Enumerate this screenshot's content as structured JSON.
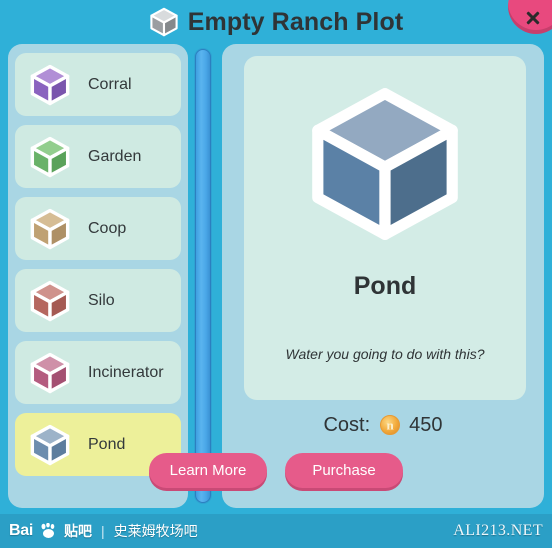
{
  "header": {
    "title": "Empty Ranch Plot",
    "icon": "cube-icon"
  },
  "close_button": {
    "icon": "close-icon",
    "color": "#e8497e"
  },
  "sidebar": {
    "background": "#a9d6e4",
    "items": [
      {
        "label": "Corral",
        "icon": "cube-icon",
        "top": "#b18fd6",
        "left": "#8a63bf",
        "right": "#7a55ad",
        "selected": false
      },
      {
        "label": "Garden",
        "icon": "cube-icon",
        "top": "#93ce8e",
        "left": "#6ab269",
        "right": "#5aa25a",
        "selected": false
      },
      {
        "label": "Coop",
        "icon": "cube-icon",
        "top": "#d6bd95",
        "left": "#bfa173",
        "right": "#ae9065",
        "selected": false
      },
      {
        "label": "Silo",
        "icon": "cube-icon",
        "top": "#cf928c",
        "left": "#b5675f",
        "right": "#a55a53",
        "selected": false
      },
      {
        "label": "Incinerator",
        "icon": "cube-icon",
        "top": "#cf90a8",
        "left": "#b45c7f",
        "right": "#a45072",
        "selected": false
      },
      {
        "label": "Pond",
        "icon": "cube-icon",
        "top": "#9db3c9",
        "left": "#6d8dae",
        "right": "#5d7d9e",
        "selected": true
      }
    ],
    "selected_background": "#edf09a",
    "item_background": "#cfeae2"
  },
  "scrollbar": {
    "name": "vertical-scrollbar",
    "thumb_color": "#4aa7e8",
    "track_color": "#2ea3d2"
  },
  "detail": {
    "name": "Pond",
    "description": "Water you going to do with this?",
    "icon": "cube-icon",
    "cube_top": "#93a9c1",
    "cube_left": "#5b81a6",
    "cube_right": "#4d6e8c",
    "card_background": "#d3ece6"
  },
  "cost": {
    "label": "Cost:",
    "value": "450",
    "currency_icon": "coin-icon",
    "coin_color": "#f2a93a"
  },
  "actions": {
    "learn_more": "Learn More",
    "purchase": "Purchase",
    "button_color": "#e65b8a"
  },
  "watermark": {
    "baidu": "Bai",
    "paw_icon": "paw-icon",
    "tieba": "贴吧",
    "separator": "|",
    "forum": "史莱姆牧场吧",
    "site": "ALI213.NET"
  }
}
